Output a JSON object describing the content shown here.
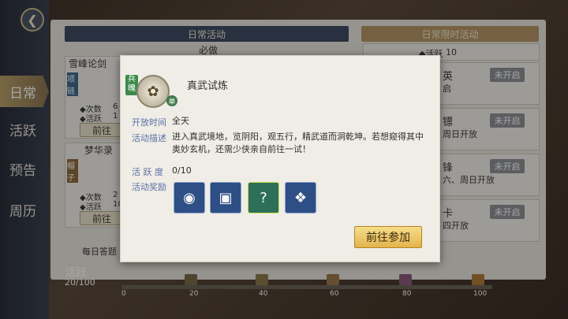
{
  "nav": {
    "back_icon": "back-arrow-icon",
    "items": [
      {
        "label": "日常",
        "active": true
      },
      {
        "label": "活跃",
        "active": false
      },
      {
        "label": "预告",
        "active": false
      },
      {
        "label": "周历",
        "active": false
      }
    ]
  },
  "background": {
    "daily_header": "日常活动",
    "limited_header": "日常限时活动",
    "must_do": "必做",
    "cards": [
      {
        "title": "雪峰论剑",
        "tag": "项链",
        "count_label": "◆次数",
        "count_value": "6",
        "active_label": "◆活跃",
        "active_value": "1",
        "button": "前往"
      },
      {
        "title": "梦华录",
        "tag": "帽子",
        "count_label": "◆次数",
        "count_value": "2",
        "active_label": "◆活跃",
        "active_value": "10",
        "button": "前往"
      }
    ],
    "daily_third": "每日答题",
    "limited": [
      {
        "name": "",
        "line": "◆活跃",
        "value": "10"
      },
      {
        "name": "英",
        "line": "启",
        "status": "未开启"
      },
      {
        "name": "镖",
        "line": "周日开放",
        "status": "未开启"
      },
      {
        "name": "锋",
        "line": "六、周日开放",
        "status": "未开启"
      },
      {
        "name": "卡",
        "line": "四开放",
        "status": "未开启"
      }
    ]
  },
  "activity": {
    "label": "活跃",
    "value": "20/100",
    "ticks": [
      "0",
      "20",
      "40",
      "60",
      "80",
      "100"
    ]
  },
  "modal": {
    "tag": "兵魄",
    "single": "单",
    "icon": "gear-emblem-icon",
    "title": "真武试炼",
    "open_time_label": "开放时间",
    "open_time_value": "全天",
    "desc_label": "活动描述",
    "desc_value": "进入真武境地，览阴阳，观五行，精武道而洞乾坤。若想窥得其中奥妙玄机，还需少侠亲自前往一试！",
    "activity_label": "活 跃 度",
    "activity_value": "0/10",
    "reward_label": "活动奖励",
    "rewards": [
      {
        "icon": "golden-orb-icon",
        "color": "#2d4f86"
      },
      {
        "icon": "silver-coin-icon",
        "color": "#2d4f86"
      },
      {
        "icon": "mystery-box-icon",
        "color": "#2e6f5a"
      },
      {
        "icon": "jade-crystal-icon",
        "color": "#2d4f86"
      }
    ],
    "join_button": "前往参加"
  }
}
